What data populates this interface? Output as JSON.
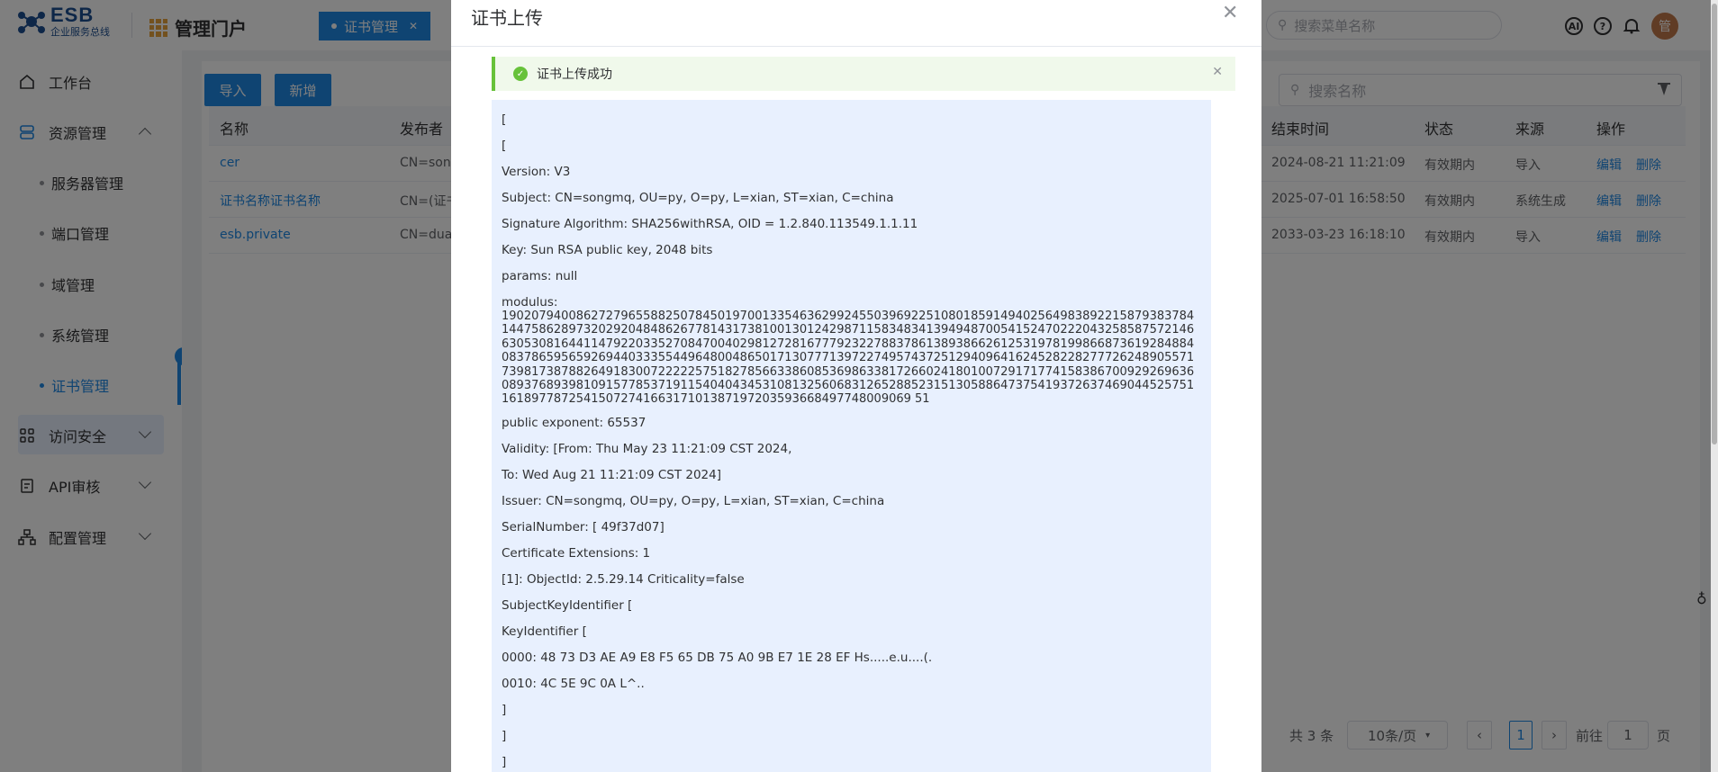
{
  "header": {
    "logo_big": "ESB",
    "logo_small": "企业服务总线",
    "portal_title": "管理门户",
    "active_tab": "证书管理",
    "search_placeholder": "搜索菜单名称",
    "avatar_text": "管"
  },
  "sidebar": {
    "workbench": "工作台",
    "resource": "资源管理",
    "sub": [
      "服务器管理",
      "端口管理",
      "域管理",
      "系统管理",
      "证书管理"
    ],
    "access": "访问安全",
    "api_audit": "API审核",
    "config": "配置管理"
  },
  "toolbar": {
    "import_label": "导入",
    "add_label": "新增",
    "search_placeholder": "搜索名称"
  },
  "table": {
    "headers": {
      "name": "名称",
      "publisher": "发布者",
      "end_time": "结束时间",
      "status": "状态",
      "source": "来源",
      "action": "操作"
    },
    "rows": [
      {
        "name": "cer",
        "publisher": "CN=songm",
        "end_time": "2024-08-21 11:21:09",
        "status": "有效期内",
        "source": "导入",
        "edit": "编辑",
        "del": "删除"
      },
      {
        "name": "证书名称证书名称",
        "publisher": "CN=(证书",
        "end_time": "2025-07-01 16:58:50",
        "status": "有效期内",
        "source": "系统生成",
        "edit": "编辑",
        "del": "删除"
      },
      {
        "name": "esb.private",
        "publisher": "CN=duan",
        "end_time": "2033-03-23 16:18:10",
        "status": "有效期内",
        "source": "导入",
        "edit": "编辑",
        "del": "删除"
      }
    ]
  },
  "pagination": {
    "total": "共 3 条",
    "page_size": "10条/页",
    "current": "1",
    "goto_label": "前往",
    "goto_value": "1",
    "page_suffix": "页"
  },
  "modal": {
    "title": "证书上传",
    "alert": "证书上传成功",
    "lines_before": [
      "[",
      "[",
      "Version: V3",
      "Subject: CN=songmq, OU=py, O=py, L=xian, ST=xian, C=china",
      "Signature Algorithm: SHA256withRSA, OID = 1.2.840.113549.1.1.11",
      "Key: Sun RSA public key, 2048 bits",
      "params: null"
    ],
    "modulus_label": "modulus:",
    "modulus": "1902079400862727965588250784501970013354636299245503969225108018591494025649838922158793837841447586289732029204848626778143173810013012429871158348341394948700541524702220432585875721466305308164411479220335270847004029812728167779232278837861389386626125319781998668736192848840837865956592694403335544964800486501713077713972274957437251294096416245282282777262489055717398173878826491830072222257518278566338608536986338172660241801007291717741583867009292696360893768939810915778537191154040434531081325606831265288523151305886473754193726374690445257511618977872541507274166317101387197203593668497748009069 51",
    "lines_after": [
      "public exponent: 65537",
      "Validity: [From: Thu May 23 11:21:09 CST 2024,",
      "To: Wed Aug 21 11:21:09 CST 2024]",
      "Issuer: CN=songmq, OU=py, O=py, L=xian, ST=xian, C=china",
      "SerialNumber: [ 49f37d07]",
      "Certificate Extensions: 1",
      "[1]: ObjectId: 2.5.29.14 Criticality=false",
      "SubjectKeyIdentifier [",
      "KeyIdentifier [",
      "0000: 48 73 D3 AE A9 E8 F5 65 DB 75 A0 9B E7 1E 28 EF Hs.....e.u....(.",
      "0010: 4C 5E 9C 0A L^..",
      "]",
      "]",
      "]"
    ]
  },
  "colors": {
    "primary": "#1e88e5",
    "success": "#67c23a",
    "overlay": "rgba(0,0,0,0.5)"
  }
}
